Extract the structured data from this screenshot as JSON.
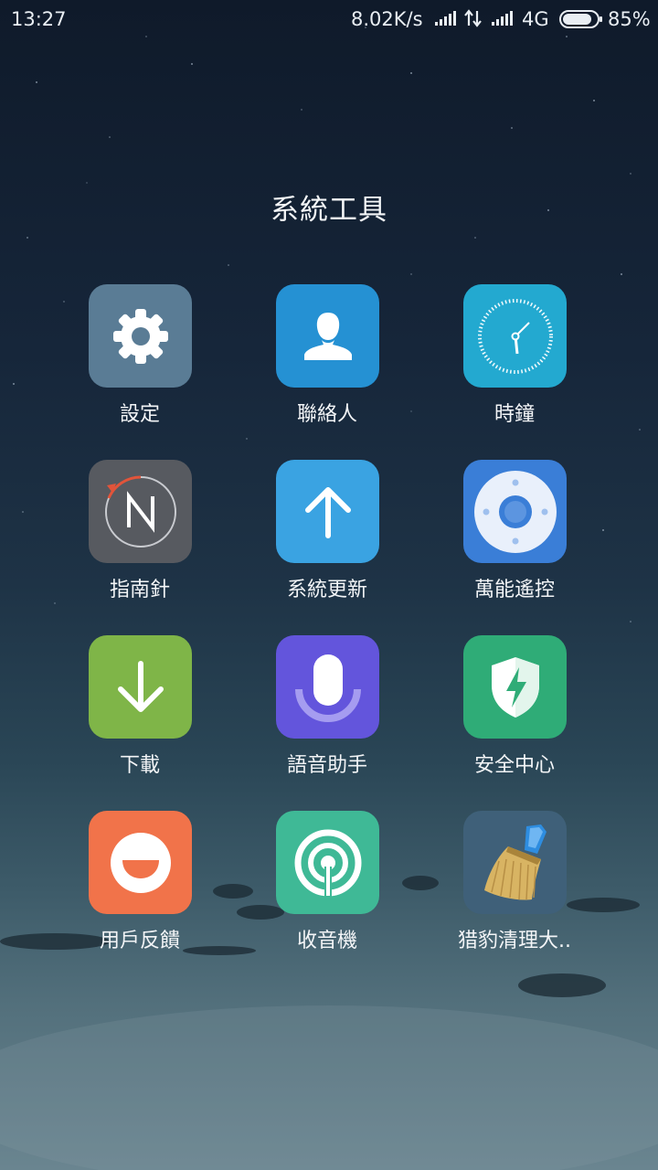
{
  "status_bar": {
    "time": "13:27",
    "speed": "8.02K/s",
    "network": "4G",
    "battery": "85%",
    "battery_level": 0.85
  },
  "folder": {
    "title": "系統工具",
    "apps": [
      {
        "label": "設定",
        "icon": "gear-icon",
        "color": "#5a7c95"
      },
      {
        "label": "聯絡人",
        "icon": "person-icon",
        "color": "#2591d3"
      },
      {
        "label": "時鐘",
        "icon": "clock-icon",
        "color": "#23a9d0"
      },
      {
        "label": "指南針",
        "icon": "compass-icon",
        "color": "#575a60"
      },
      {
        "label": "系統更新",
        "icon": "arrow-up-icon",
        "color": "#3aa3e2"
      },
      {
        "label": "萬能遙控",
        "icon": "remote-control-icon",
        "color": "#3a7ed7"
      },
      {
        "label": "下載",
        "icon": "arrow-down-icon",
        "color": "#7fb548"
      },
      {
        "label": "語音助手",
        "icon": "microphone-icon",
        "color": "#6355dc"
      },
      {
        "label": "安全中心",
        "icon": "shield-icon",
        "color": "#2fac77"
      },
      {
        "label": "用戶反饋",
        "icon": "smile-icon",
        "color": "#f1734a"
      },
      {
        "label": "收音機",
        "icon": "radio-icon",
        "color": "#3fb996"
      },
      {
        "label": "猎豹清理大..",
        "icon": "broom-icon",
        "color": "#3f6079"
      }
    ]
  }
}
